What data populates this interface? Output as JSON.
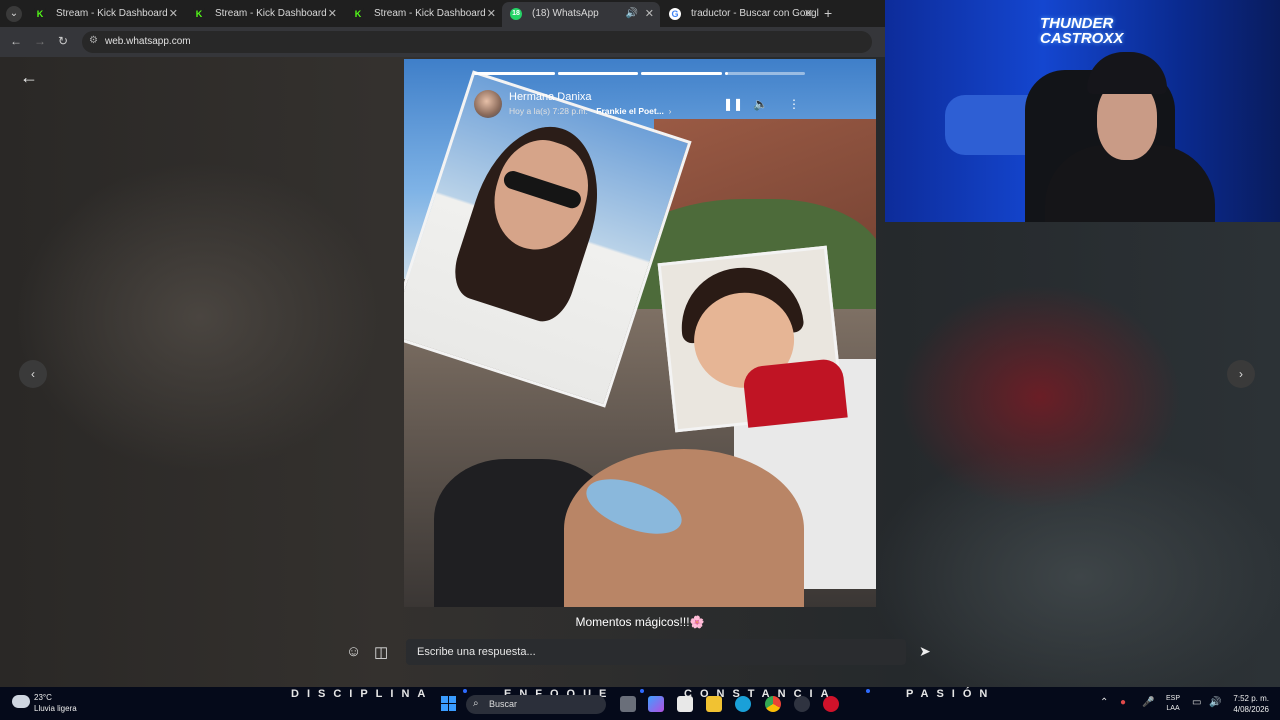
{
  "browser": {
    "tabs": [
      {
        "title": "Stream - Kick Dashboard",
        "favicon": "kick-icon"
      },
      {
        "title": "Stream - Kick Dashboard",
        "favicon": "kick-icon"
      },
      {
        "title": "Stream - Kick Dashboard",
        "favicon": "kick-icon"
      },
      {
        "title": "(18) WhatsApp",
        "favicon": "whatsapp-icon",
        "active": true,
        "audio": true
      },
      {
        "title": "traductor - Buscar con Google",
        "favicon": "google-icon"
      }
    ],
    "url": "web.whatsapp.com"
  },
  "status": {
    "contact_name": "Hermana Danixa",
    "time": "Hoy a la(s) 7:28 p.m.",
    "song": "Frankie el Poet...",
    "caption": "Momentos mágicos!!!🌸",
    "reply_placeholder": "Escribe una respuesta...",
    "progress": [
      1,
      1,
      1,
      0.04
    ]
  },
  "overlay": {
    "brand_line1": "THUNDER",
    "brand_line2": "CASTROXX",
    "ticker_words": [
      "DISCIPLINA",
      "ENFOQUE",
      "CONSTANCIA",
      "PASIÓN"
    ]
  },
  "taskbar": {
    "temperature": "23°C",
    "weather": "Lluvia ligera",
    "search_label": "Buscar",
    "lang_line1": "ESP",
    "lang_line2": "LAA",
    "time": "7:52 p. m.",
    "date": "4/08/2026"
  },
  "colors": {
    "whatsapp_green": "#25d366",
    "kick_green": "#53fc18",
    "taskbar_bg": "#050a1a"
  }
}
